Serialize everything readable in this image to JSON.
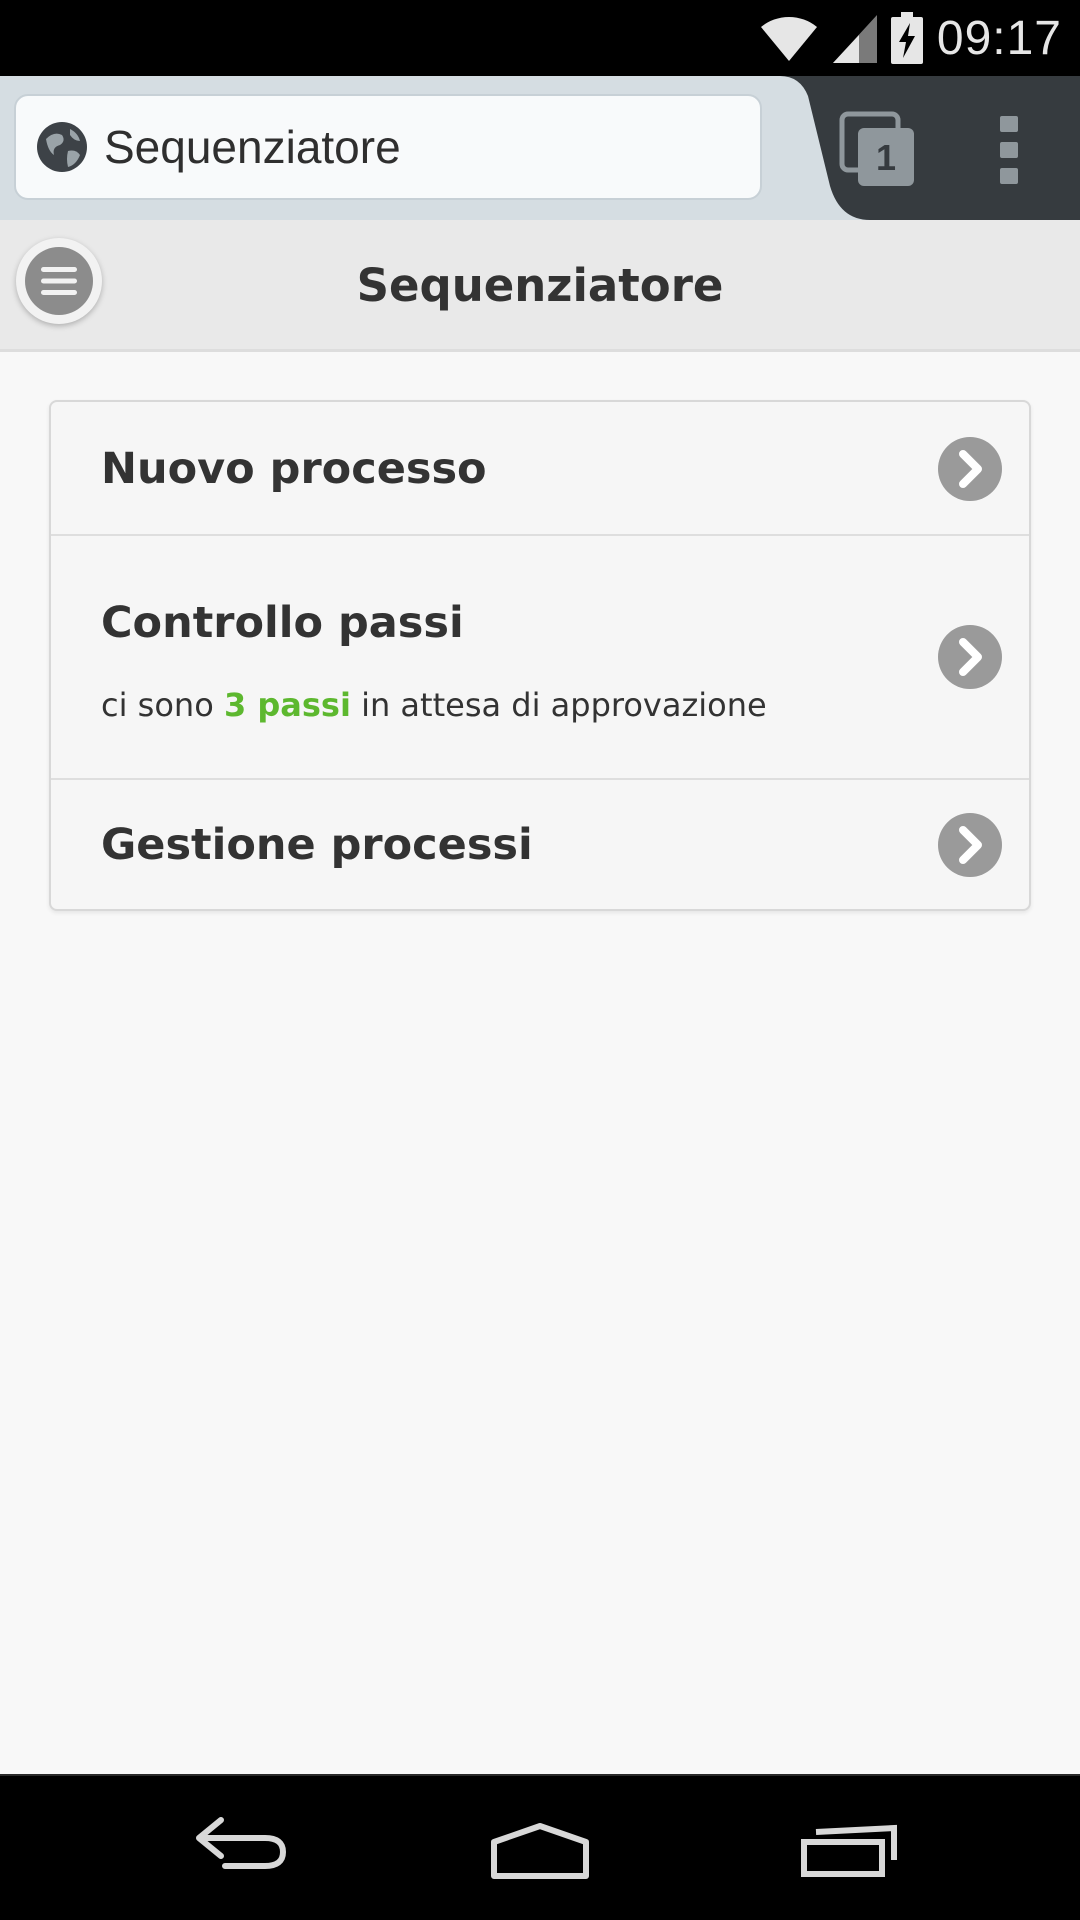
{
  "status_bar": {
    "time": "09:17",
    "icons": [
      "wifi-icon",
      "signal-icon",
      "battery-charging-icon"
    ]
  },
  "browser": {
    "url_text": "Sequenziatore",
    "tab_count": "1",
    "icons": [
      "globe-icon",
      "tabs-icon",
      "overflow-menu-icon"
    ]
  },
  "header": {
    "title": "Sequenziatore",
    "menu_icon": "hamburger-menu-icon"
  },
  "list": {
    "items": [
      {
        "title": "Nuovo processo",
        "icon": "chevron-right-icon"
      },
      {
        "title": "Controllo passi",
        "subtitle_prefix": "ci sono",
        "subtitle_highlight": "3 passi",
        "subtitle_suffix": "in attesa di approvazione",
        "icon": "chevron-right-icon"
      },
      {
        "title": "Gestione processi",
        "icon": "chevron-right-icon"
      }
    ]
  },
  "nav_bar": {
    "icons": [
      "back-icon",
      "home-icon",
      "recents-icon"
    ]
  },
  "colors": {
    "highlight": "#5db82f",
    "browser_chrome": "#363b3f",
    "chevron_circle": "#9a9a9a"
  }
}
